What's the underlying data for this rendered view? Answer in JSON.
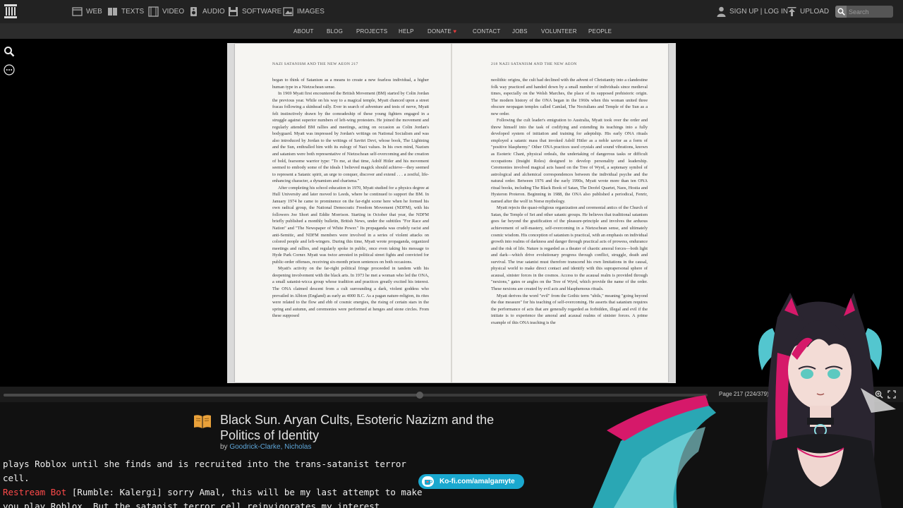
{
  "nav": {
    "menu": [
      {
        "label": "WEB",
        "icon": "web-icon"
      },
      {
        "label": "TEXTS",
        "icon": "book-icon"
      },
      {
        "label": "VIDEO",
        "icon": "film-icon"
      },
      {
        "label": "AUDIO",
        "icon": "speaker-icon"
      },
      {
        "label": "SOFTWARE",
        "icon": "floppy-icon"
      },
      {
        "label": "IMAGES",
        "icon": "image-icon"
      }
    ],
    "signup_label": "SIGN UP | LOG IN",
    "upload_label": "UPLOAD",
    "search_placeholder": "Search"
  },
  "subnav": [
    "ABOUT",
    "BLOG",
    "PROJECTS",
    "HELP",
    "DONATE",
    "CONTACT",
    "JOBS",
    "VOLUNTEER",
    "PEOPLE"
  ],
  "book": {
    "left_header": "NAZI SATANISM AND THE NEW AEON   217",
    "right_header": "218   NAZI SATANISM AND THE NEW AEON",
    "left_paragraphs": [
      "began to think of Satanism as a means to create a new fearless individual, a higher human type in a Nietzschean sense.",
      "In 1969 Myatt first encountered the British Movement (BM) started by Colin Jordan the previous year. While on his way to a magical temple, Myatt chanced upon a street fracas following a skinhead rally. Ever in search of adventure and tests of nerve, Myatt felt instinctively drawn by the comradeship of these young fighters engaged in a struggle against superior numbers of left-wing protesters. He joined the movement and regularly attended BM rallies and meetings, acting on occasion as Colin Jordan's bodyguard. Myatt was impressed by Jordan's writings on National Socialism and was also introduced by Jordan to the writings of Savitri Devi, whose book, The Lightning and the Sun, enthralled him with its eulogy of Nazi values. In his own mind, Nazism and satanism were both representative of Nietzschean self-overcoming and the creation of bold, fearsome warrior type: \"To me, at that time, Adolf Hitler and his movement seemed to embody some of the ideals I believed magick should achieve—they seemed to represent a Satanic spirit, an urge to conquer, discover and extend . . . a zestful, life-enhancing character, a dynamism and charisma.\"",
      "After completing his school education in 1970, Myatt studied for a physics degree at Hull University and later moved to Leeds, where he continued to support the BM. In January 1974 he came to prominence on the far-right scene here when he formed his own radical group, the National Democratic Freedom Movement (NDFM), with his followers Joe Short and Eddie Morrison. Starting in October that year, the NDFM briefly published a monthly bulletin, British News, under the subtitles \"For Race and Nation\" and \"The Newspaper of White Power.\" Its propaganda was crudely racist and anti-Semitic, and NDFM members were involved in a series of violent attacks on colored people and left-wingers. During this time, Myatt wrote propaganda, organized meetings and rallies, and regularly spoke in public, once even taking his message to Hyde Park Corner. Myatt was twice arrested in political street fights and convicted for public-order offenses, receiving six-month prison sentences on both occasions.",
      "Myatt's activity on the far-right political fringe proceeded in tandem with his deepening involvement with the black arts. In 1973 he met a woman who led the ONA, a small satanist-wicca group whose tradition and practices greatly excited his interest. The ONA claimed descent from a cult surrounding a dark, violent goddess who prevailed in Albion (England) as early as 4000 B.C. As a pagan nature-religion, its rites were related to the flow and ebb of cosmic energies, the rising of certain stars in the spring and autumn, and ceremonies were performed at henges and stone circles. From these supposed"
    ],
    "right_paragraphs": [
      "neolithic origins, the cult had declined with the advent of Christianity into a clandestine folk way practiced and handed down by a small number of individuals since medieval times, especially on the Welsh Marches, the place of its supposed prehistoric origin. The modern history of the ONA began in the 1960s when this woman united three obscure neopagan temples called Camlad, The Noctulians and Temple of the Sun as a new order.",
      "Following the cult leader's emigration to Australia, Myatt took over the order and threw himself into the task of codifying and extending its teachings into a fully developed system of initiation and training for adeptship. His early ONA rituals employed a satanic mass that invoked Adolf Hitler as a noble savior as a form of \"positive blasphemy.\" Other ONA practices used crystals and sound vibrations, known as Esoteric Chant, physical ordeals, the undertaking of dangerous tasks or difficult occupations (Insight Roles) designed to develop personality and leadership. Ceremonies involved magical acts based on the Tree of Wyrd, a septenary symbol of astrological and alchemical correspondences between the individual psyche and the natural order. Between 1976 and the early 1990s, Myatt wrote more than ten ONA ritual books, including The Black Book of Satan, The Deofel Quartet, Naos, Hostia and Hysteron Proteron. Beginning in 1988, the ONA also published a periodical, Fenrir, named after the wolf in Norse mythology.",
      "Myatt rejects the quasi-religious organization and ceremonial antics of the Church of Satan, the Temple of Set and other satanic groups. He believes that traditional satanism goes far beyond the gratification of the pleasure-principle and involves the arduous achievement of self-mastery, self-overcoming in a Nietzschean sense, and ultimately cosmic wisdom. His conception of satanism is practical, with an emphasis on individual growth into realms of darkness and danger through practical acts of prowess, endurance and the risk of life. Nature is regarded as a theater of chaotic amoral forces—both light and dark—which drive evolutionary progress through conflict, struggle, death and survival. The true satanist must therefore transcend his own limitations in the causal, physical world to make direct contact and identify with this suprapersonal sphere of acausal, sinister forces in the cosmos. Access to the acausal realm is provided through \"nexions,\" gates or angles on the Tree of Wyrd, which provide the name of the order. These nexions are created by evil acts and blasphemous rituals.",
      "Myatt derives the word \"evil\" from the Gothic term \"ubils,\" meaning \"going beyond the due measure\" for his teaching of self-overcoming. He asserts that satanism requires the performance of acts that are generally regarded as forbidden, illegal and evil if the initiate is to experience the amoral and acausal realms of sinister forces. A prime example of this ONA teaching is the"
    ]
  },
  "viewer": {
    "page_info": "Page 217 (224/379)",
    "progress_fraction": 0.591
  },
  "item": {
    "title": "Black Sun. Aryan Cults, Esoteric Nazizm and the Politics of Identity",
    "by_label": "by",
    "author": "Goodrick-Clarke, Nicholas"
  },
  "chat": {
    "line1": "plays Roblox until she finds and is recruited into the trans-satanist terror cell.",
    "bot_name": "Restream Bot",
    "line2_msg": " [Rumble: Kalergi] sorry Amal, this will be my last attempt to make",
    "line3": "you play Roblox. But the satanist terror cell reinvigorates my interest."
  },
  "kofi": {
    "label": "Ko-fi.com/amalgamyte"
  },
  "colors": {
    "topbar": "#222222",
    "link_blue": "#5ea6d8",
    "bot_red": "#ff4a4a",
    "kofi_blue": "#1aa8cf",
    "donate_heart": "#e23b3b"
  }
}
